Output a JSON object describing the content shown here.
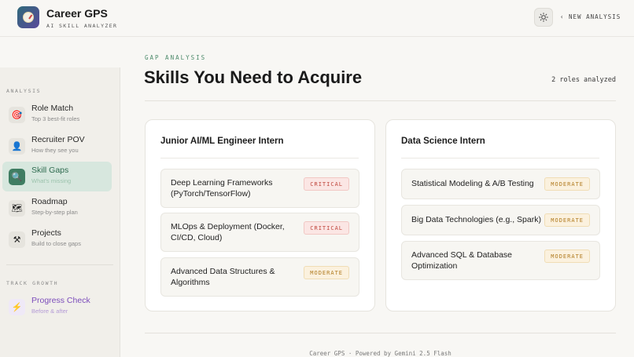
{
  "header": {
    "title": "Career GPS",
    "subtitle": "AI SKILL ANALYZER",
    "new_analysis_label": "NEW ANALYSIS",
    "icons": {
      "logo": "compass-icon",
      "theme": "sun-icon",
      "back": "chevron-left-icon"
    }
  },
  "sidebar": {
    "sections": [
      {
        "label": "ANALYSIS"
      },
      {
        "label": "TRACK GROWTH"
      }
    ],
    "items": [
      {
        "title": "Role Match",
        "desc": "Top 3 best-fit roles",
        "icon": "target-icon",
        "glyph": "🎯"
      },
      {
        "title": "Recruiter POV",
        "desc": "How they see you",
        "icon": "person-icon",
        "glyph": "👤"
      },
      {
        "title": "Skill Gaps",
        "desc": "What's missing",
        "icon": "magnifier-icon",
        "glyph": "🔍"
      },
      {
        "title": "Roadmap",
        "desc": "Step-by-step plan",
        "icon": "map-icon",
        "glyph": "🗺"
      },
      {
        "title": "Projects",
        "desc": "Build to close gaps",
        "icon": "tools-icon",
        "glyph": "⚒"
      },
      {
        "title": "Progress Check",
        "desc": "Before & after",
        "icon": "lightning-icon",
        "glyph": "⚡"
      }
    ],
    "active_item": "Skill Gaps"
  },
  "main": {
    "eyebrow": "GAP ANALYSIS",
    "title": "Skills You Need to Acquire",
    "roles_count": "2 roles analyzed",
    "cards": [
      {
        "title": "Junior AI/ML Engineer Intern",
        "skills": [
          {
            "name": "Deep Learning Frameworks (PyTorch/TensorFlow)",
            "level": "CRITICAL"
          },
          {
            "name": "MLOps & Deployment (Docker, CI/CD, Cloud)",
            "level": "CRITICAL"
          },
          {
            "name": "Advanced Data Structures & Algorithms",
            "level": "MODERATE"
          }
        ]
      },
      {
        "title": "Data Science Intern",
        "skills": [
          {
            "name": "Statistical Modeling & A/B Testing",
            "level": "MODERATE"
          },
          {
            "name": "Big Data Technologies (e.g., Spark)",
            "level": "MODERATE"
          },
          {
            "name": "Advanced SQL & Database Optimization",
            "level": "MODERATE"
          }
        ]
      }
    ]
  },
  "footer": {
    "text": "Career GPS · Powered by Gemini 2.5 Flash"
  },
  "colors": {
    "accent_green": "#3f7d62",
    "critical": "#c0463c",
    "moderate": "#b07a1e",
    "purple": "#7c4dbb"
  }
}
